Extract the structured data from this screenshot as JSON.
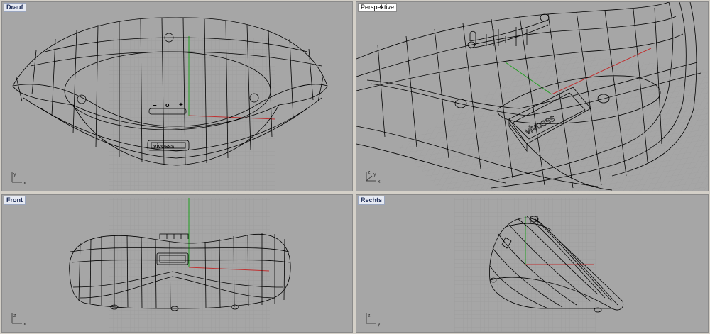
{
  "viewports": {
    "top": {
      "label": "Drauf",
      "axis_v": "y",
      "axis_h": "x"
    },
    "perspective": {
      "label": "Perspektive",
      "axis_v": "z",
      "axis_h": "x",
      "axis_d": "y"
    },
    "front": {
      "label": "Front",
      "axis_v": "z",
      "axis_h": "x"
    },
    "right": {
      "label": "Rechts",
      "axis_v": "z",
      "axis_h": "y"
    }
  },
  "model": {
    "logo_text": "vivosss",
    "button_minus": "–",
    "button_center": "o",
    "button_plus": "+"
  },
  "colors": {
    "viewport_bg": "#a6a6a6",
    "grid_line": "#9a9a9a",
    "wireframe": "#000000",
    "axis_x": "#c03030",
    "axis_y": "#20a020",
    "active_label_bg": "#e6eaf3"
  }
}
